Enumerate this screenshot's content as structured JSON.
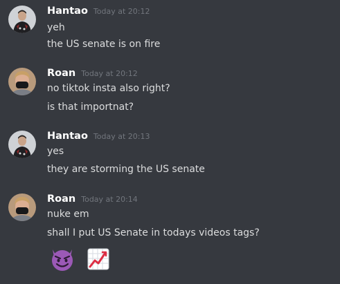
{
  "messages": [
    {
      "user": "Hantao",
      "timestamp": "Today at 20:12",
      "lines": [
        "yeh",
        "the US senate is on fire"
      ]
    },
    {
      "user": "Roan",
      "timestamp": "Today at 20:12",
      "lines": [
        "no tiktok insta also right?",
        "is that importnat?"
      ]
    },
    {
      "user": "Hantao",
      "timestamp": "Today at 20:13",
      "lines": [
        "yes",
        "they are storming the US senate"
      ]
    },
    {
      "user": "Roan",
      "timestamp": "Today at 20:14",
      "lines": [
        "nuke em",
        "shall I put US Senate in todays videos tags?"
      ],
      "emojis": [
        "smiling-devil-emoji",
        "chart-increasing-emoji"
      ]
    }
  ],
  "colors": {
    "background": "#36393f",
    "username": "#ffffff",
    "text": "#dcddde",
    "timestamp": "#72767d"
  }
}
